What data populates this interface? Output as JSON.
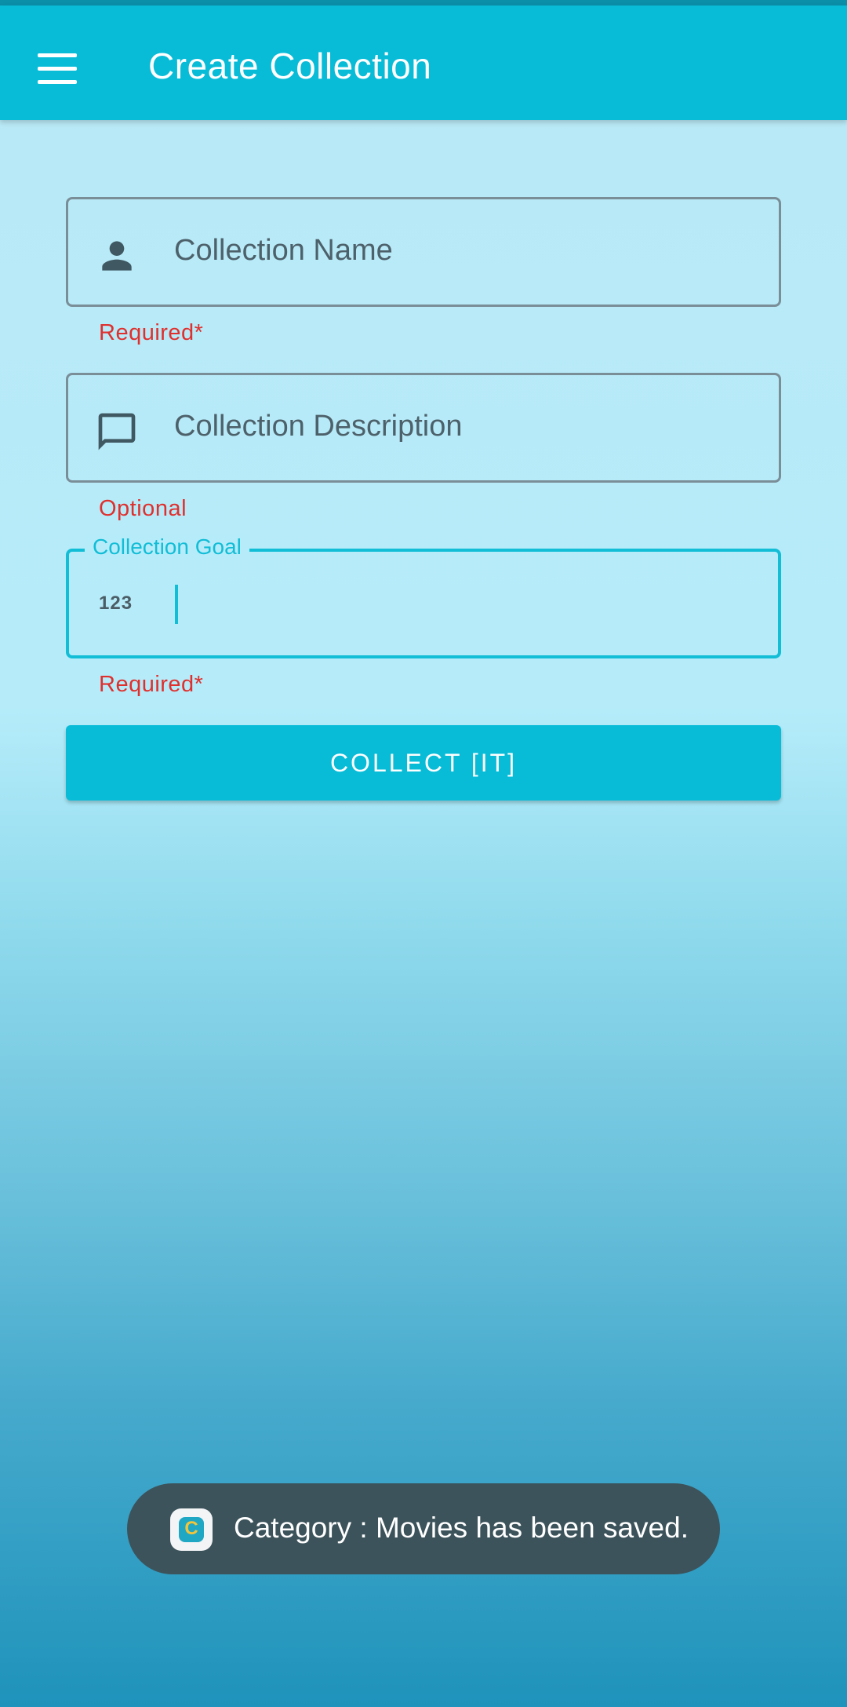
{
  "app_bar": {
    "title": "Create Collection",
    "menu_icon": "menu-icon"
  },
  "form": {
    "name_field": {
      "placeholder": "Collection Name",
      "icon": "person-icon",
      "helper": "Required*"
    },
    "description_field": {
      "placeholder": "Collection Description",
      "icon": "chat-bubble-icon",
      "helper": "Optional"
    },
    "goal_field": {
      "label": "Collection Goal",
      "value": "",
      "icon": "numeric-icon",
      "icon_text": "123",
      "helper": "Required*"
    },
    "submit_label": "COLLECT [IT]"
  },
  "toast": {
    "message": "Category : Movies has been saved.",
    "icon": "app-icon",
    "icon_letter": "C"
  },
  "colors": {
    "primary": "#08bcd8",
    "error": "#e0302e",
    "toast_bg": "#3c535b"
  }
}
